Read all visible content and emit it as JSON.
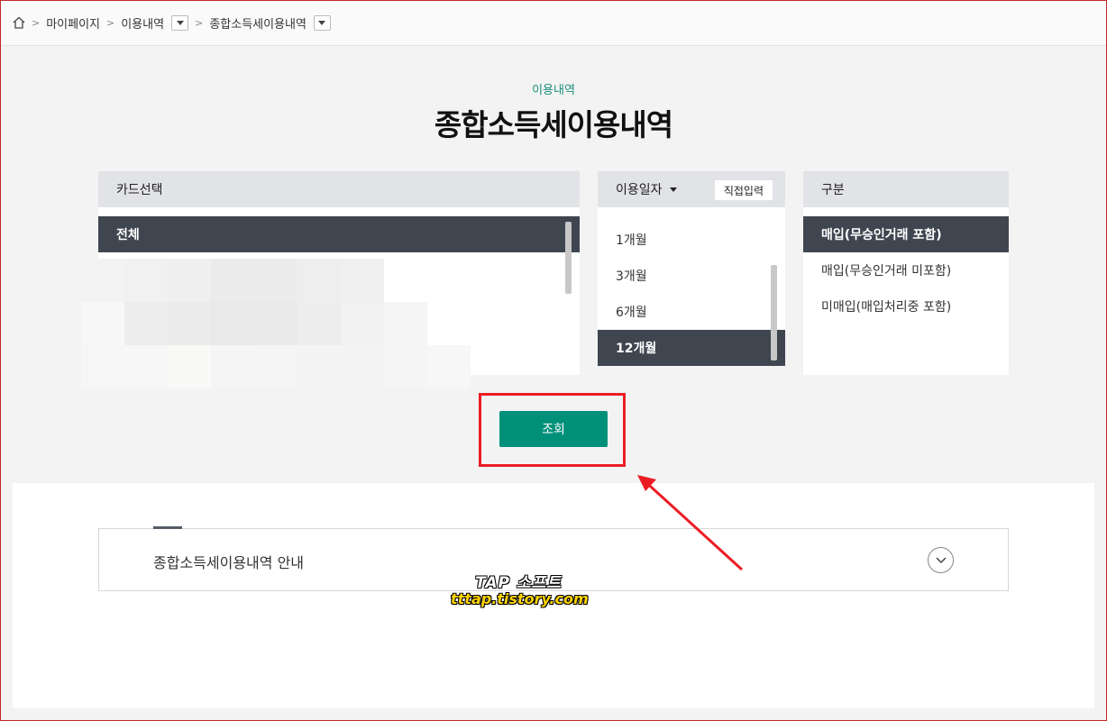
{
  "breadcrumb": {
    "items": [
      "마이페이지",
      "이용내역",
      "종합소득세이용내역"
    ]
  },
  "header": {
    "subtitle": "이용내역",
    "title": "종합소득세이용내역"
  },
  "card_panel": {
    "heading": "카드선택",
    "options": [
      "전체"
    ]
  },
  "date_panel": {
    "heading": "이용일자",
    "direct_input_label": "직접입력",
    "options": [
      "1개월",
      "3개월",
      "6개월",
      "12개월"
    ],
    "selected": "12개월"
  },
  "type_panel": {
    "heading": "구분",
    "options": [
      "매입(무승인거래 포함)",
      "매입(무승인거래 미포함)",
      "미매입(매입처리중 포함)"
    ],
    "selected": "매입(무승인거래 포함)"
  },
  "search_button": {
    "label": "조회"
  },
  "guide": {
    "label": "종합소득세이용내역 안내"
  },
  "watermark": {
    "line1": "TAP 소프트",
    "line2": "tttap.tistory.com"
  },
  "colors": {
    "accent": "#00907a",
    "selected_row": "#3f4650",
    "highlight": "#ec1c24"
  }
}
